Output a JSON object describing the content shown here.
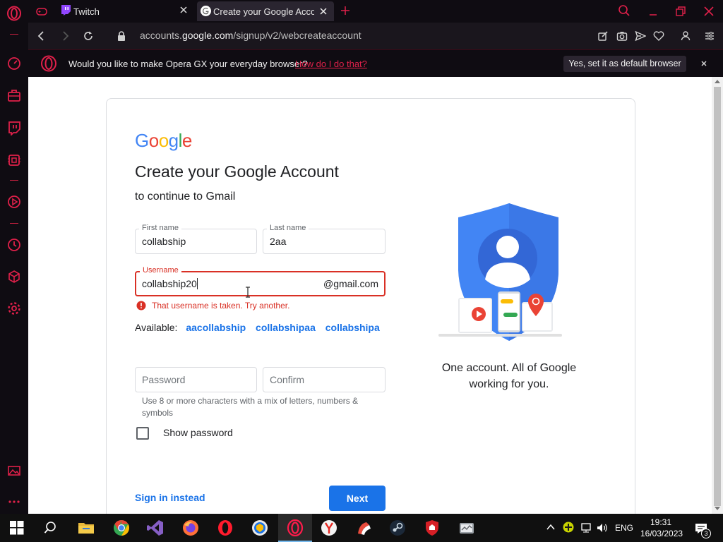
{
  "browser": {
    "tabs": [
      {
        "label": "Twitch",
        "active": false
      },
      {
        "label": "Create your Google Account",
        "active": true
      }
    ],
    "url_prefix": "accounts.",
    "url_domain": "google.com",
    "url_path": "/signup/v2/webcreateaccount",
    "infobar": {
      "message": "Would you like to make Opera GX your everyday browser?",
      "link": "How do I do that?",
      "button": "Yes, set it as default browser"
    },
    "accent": "#e0204a"
  },
  "signup": {
    "logo": [
      "G",
      "o",
      "o",
      "g",
      "l",
      "e"
    ],
    "title": "Create your Google Account",
    "subtitle": "to continue to Gmail",
    "first_name": {
      "label": "First name",
      "value": "collabship"
    },
    "last_name": {
      "label": "Last name",
      "value": "2aa"
    },
    "username": {
      "label": "Username",
      "value": "collabship20",
      "suffix": "@gmail.com"
    },
    "error": "That username is taken. Try another.",
    "available_label": "Available:",
    "suggestions": [
      "aacollabship",
      "collabshipaa",
      "collabshipa"
    ],
    "password": {
      "placeholder": "Password"
    },
    "confirm": {
      "placeholder": "Confirm"
    },
    "password_hint": "Use 8 or more characters with a mix of letters, numbers & symbols",
    "show_password": "Show password",
    "sign_in_instead": "Sign in instead",
    "next": "Next",
    "tagline": "One account. All of Google working for you."
  },
  "taskbar": {
    "language": "ENG",
    "time": "19:31",
    "date": "16/03/2023",
    "notifications": "3"
  }
}
